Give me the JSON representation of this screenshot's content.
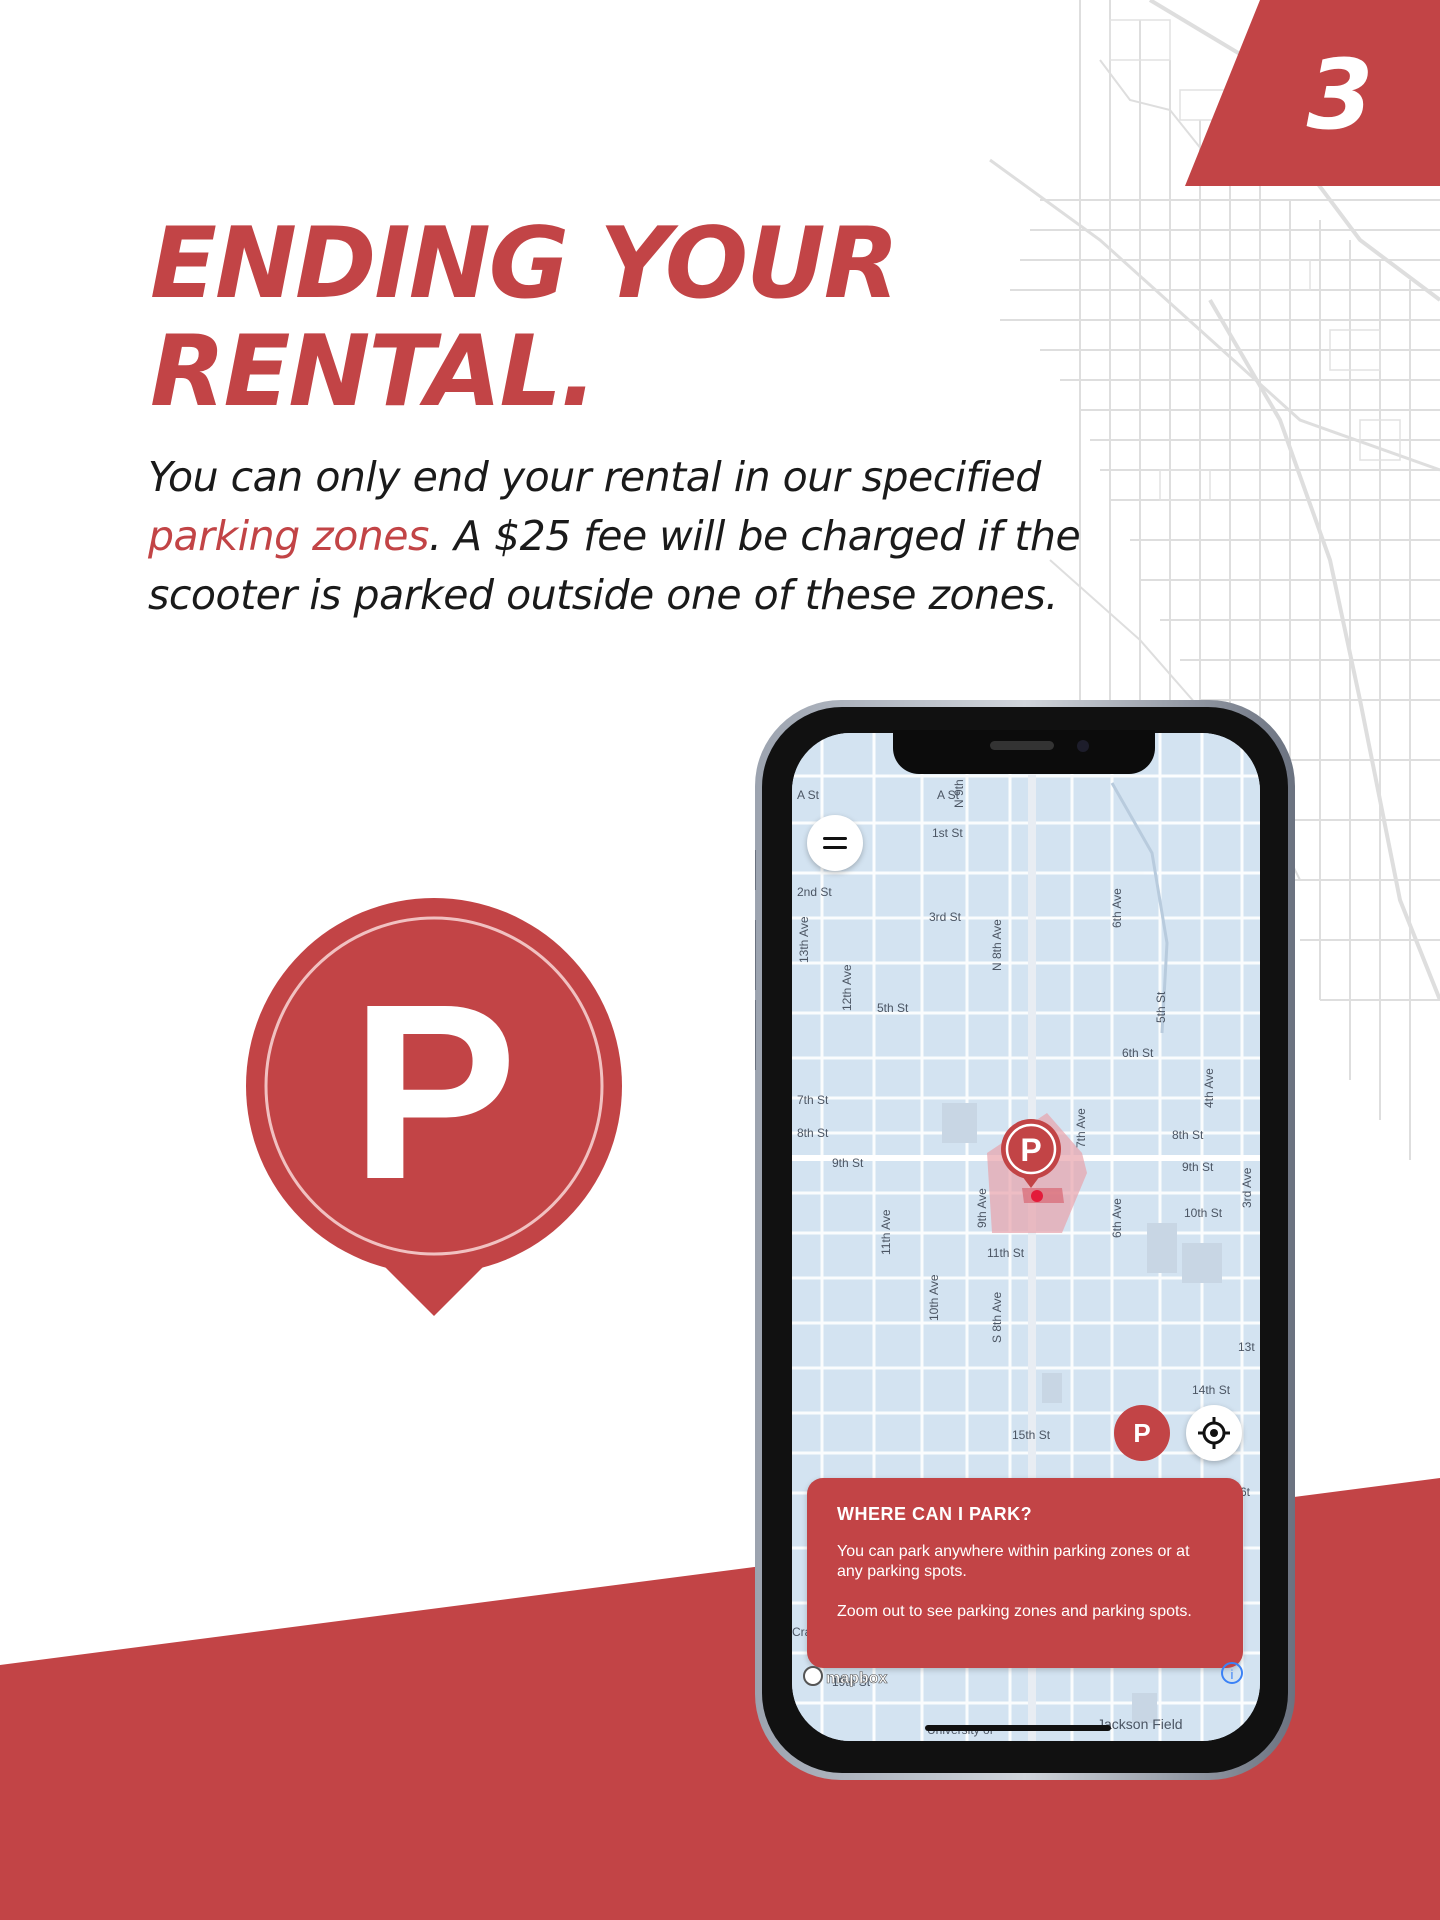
{
  "step": {
    "number": "3"
  },
  "title": {
    "line1": "ENDING YOUR",
    "line2": "RENTAL."
  },
  "body": {
    "part1": "You can only end your rental in our specified",
    "highlight": "parking zones",
    "part2": ". A $25 fee will be charged if the",
    "part3": "scooter is parked outside one of these zones."
  },
  "pin": {
    "letter": "P"
  },
  "phone": {
    "map": {
      "streets": {
        "a_st_left": "A St",
        "a_st": "A St",
        "n_9th": "N 9th",
        "first_st": "1st St",
        "second_st": "2nd St",
        "third_st": "3rd St",
        "thirteenth_ave": "13th Ave",
        "twelfth_ave": "12th Ave",
        "n_8th_ave": "N 8th Ave",
        "sixth_ave_top": "6th Ave",
        "fifth_st": "5th St",
        "fifth_st_right": "5th St",
        "sixth_st": "6th St",
        "seventh_st": "7th St",
        "eighth_st_left": "8th St",
        "fourth_ave": "4th Ave",
        "eighth_st_right": "8th St",
        "seventh_ave": "7th Ave",
        "ninth_st_left": "9th St",
        "ninth_st_right": "9th St",
        "ninth_ave": "9th Ave",
        "eleventh_ave": "11th Ave",
        "sixth_ave_bottom": "6th Ave",
        "tenth_st": "10th St",
        "third_ave": "3rd Ave",
        "eleventh_st": "11th St",
        "tenth_ave": "10th Ave",
        "s_8th_ave": "S 8th Ave",
        "thirteenth_st": "13t",
        "fourteenth_st": "14th St",
        "fifteenth_st": "15th St",
        "nineteenth_st": "19th St",
        "university": "University of",
        "jackson_field": "Jackson Field",
        "cra": "Cra",
        "sixth_edge": "6t"
      },
      "zone_pin_letter": "P",
      "parking_button_label": "P",
      "info_card": {
        "title": "WHERE CAN I PARK?",
        "paragraph1": "You can park anywhere within parking zones or at any parking spots.",
        "paragraph2": "Zoom out to see parking zones and parking spots."
      },
      "attribution": "mapbox",
      "attribution_info": "i"
    }
  },
  "colors": {
    "brand_red": "#c24446",
    "map_blue": "#d3e3f1"
  }
}
